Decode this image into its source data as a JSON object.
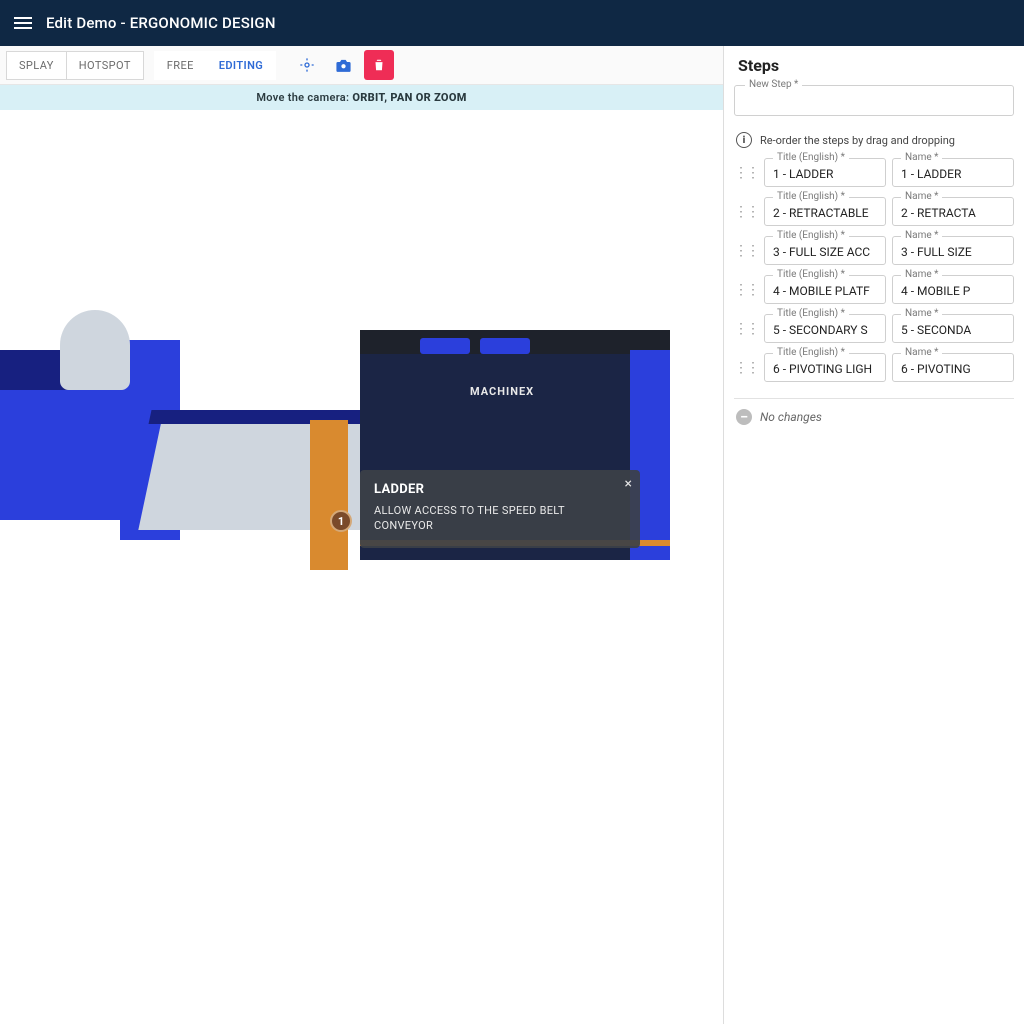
{
  "header": {
    "title": "Edit Demo - ERGONOMIC DESIGN"
  },
  "toolbar": {
    "tabs": {
      "display": "SPLAY",
      "hotspot": "HOTSPOT",
      "free": "FREE",
      "editing": "EDITING"
    }
  },
  "hint": {
    "prefix": "Move the camera: ",
    "bold": "ORBIT, PAN OR ZOOM"
  },
  "overlay": {
    "marker": "1",
    "title": "LADDER",
    "body": "ALLOW ACCESS TO THE SPEED BELT CONVEYOR",
    "brand": "MACHINEX"
  },
  "side": {
    "title": "Steps",
    "new_step_label": "New Step *",
    "reorder_hint": "Re-order the steps by drag and dropping",
    "title_label": "Title (English) *",
    "name_label": "Name *",
    "no_changes": "No changes",
    "steps": [
      {
        "title": "1 - LADDER",
        "name": "1 - LADDER"
      },
      {
        "title": "2 - RETRACTABLE",
        "name": "2 - RETRACTA"
      },
      {
        "title": "3 - FULL SIZE ACC",
        "name": "3 - FULL SIZE"
      },
      {
        "title": "4 - MOBILE PLATF",
        "name": "4 - MOBILE P"
      },
      {
        "title": "5 - SECONDARY S",
        "name": "5 - SECONDA"
      },
      {
        "title": "6 - PIVOTING LIGH",
        "name": "6 - PIVOTING"
      }
    ]
  }
}
